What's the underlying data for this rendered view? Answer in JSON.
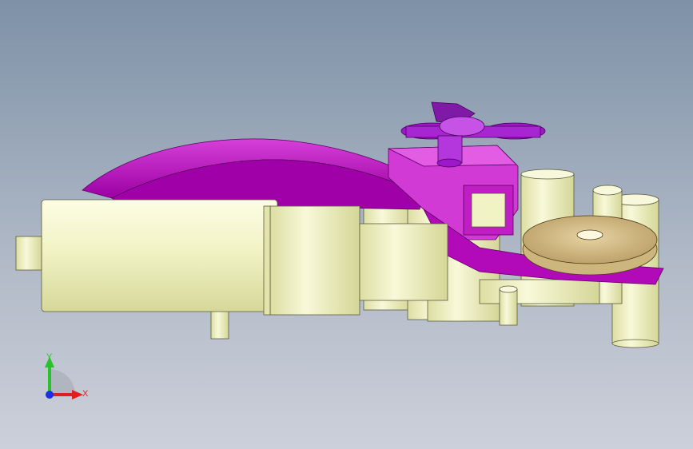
{
  "viewport": {
    "background_top": "#7e91a7",
    "background_bottom": "#ccd0da"
  },
  "model": {
    "parts": [
      {
        "name": "motor-housing",
        "color": "#f2f3c4"
      },
      {
        "name": "gear-bracket",
        "color": "#b000b6"
      },
      {
        "name": "handle-knob",
        "color": "#9d18c8"
      },
      {
        "name": "pulley-disc",
        "color": "#d4bd88"
      },
      {
        "name": "support-posts",
        "color": "#eef0bd"
      }
    ]
  },
  "triad": {
    "x_label": "X",
    "y_label": "Y",
    "x_color": "#e0201c",
    "y_color": "#29c22c",
    "z_color": "#1b2fe6"
  }
}
